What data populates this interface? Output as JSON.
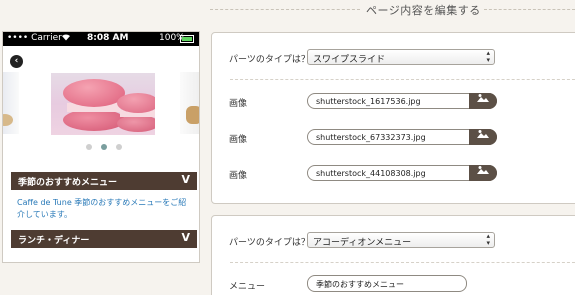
{
  "header": {
    "title": "ページ内容を編集する"
  },
  "preview": {
    "status_bar": {
      "carrier": "•••• Carrier",
      "wifi_icon": "wifi-icon",
      "time": "8:08 AM",
      "battery_percent": "100%"
    },
    "back_icon": "‹",
    "carousel": {
      "dot_count": 3,
      "active_dot": 1
    },
    "accordion": [
      {
        "title": "季節のおすすめメニュー",
        "expanded": true,
        "body": "Caffe de Tune 季節のおすすめメニューをご紹介しています。"
      },
      {
        "title": "ランチ・ディナー",
        "expanded": false
      }
    ],
    "chevron": "V"
  },
  "editor": {
    "parts": [
      {
        "type_label": "パーツのタイプは？",
        "type_value": "スワイプスライド",
        "images": [
          {
            "label": "画像",
            "file": "shutterstock_1617536.jpg"
          },
          {
            "label": "画像",
            "file": "shutterstock_67332373.jpg"
          },
          {
            "label": "画像",
            "file": "shutterstock_44108308.jpg"
          }
        ]
      },
      {
        "type_label": "パーツのタイプは？",
        "type_value": "アコーディオンメニュー",
        "menu_label": "メニュー",
        "menu_value": "季節のおすすめメニュー"
      }
    ]
  },
  "colors": {
    "background": "#f6f3ee",
    "accordion_header": "#4e3c32",
    "link_text": "#2a7ab8",
    "upload_button": "#5c5046"
  }
}
